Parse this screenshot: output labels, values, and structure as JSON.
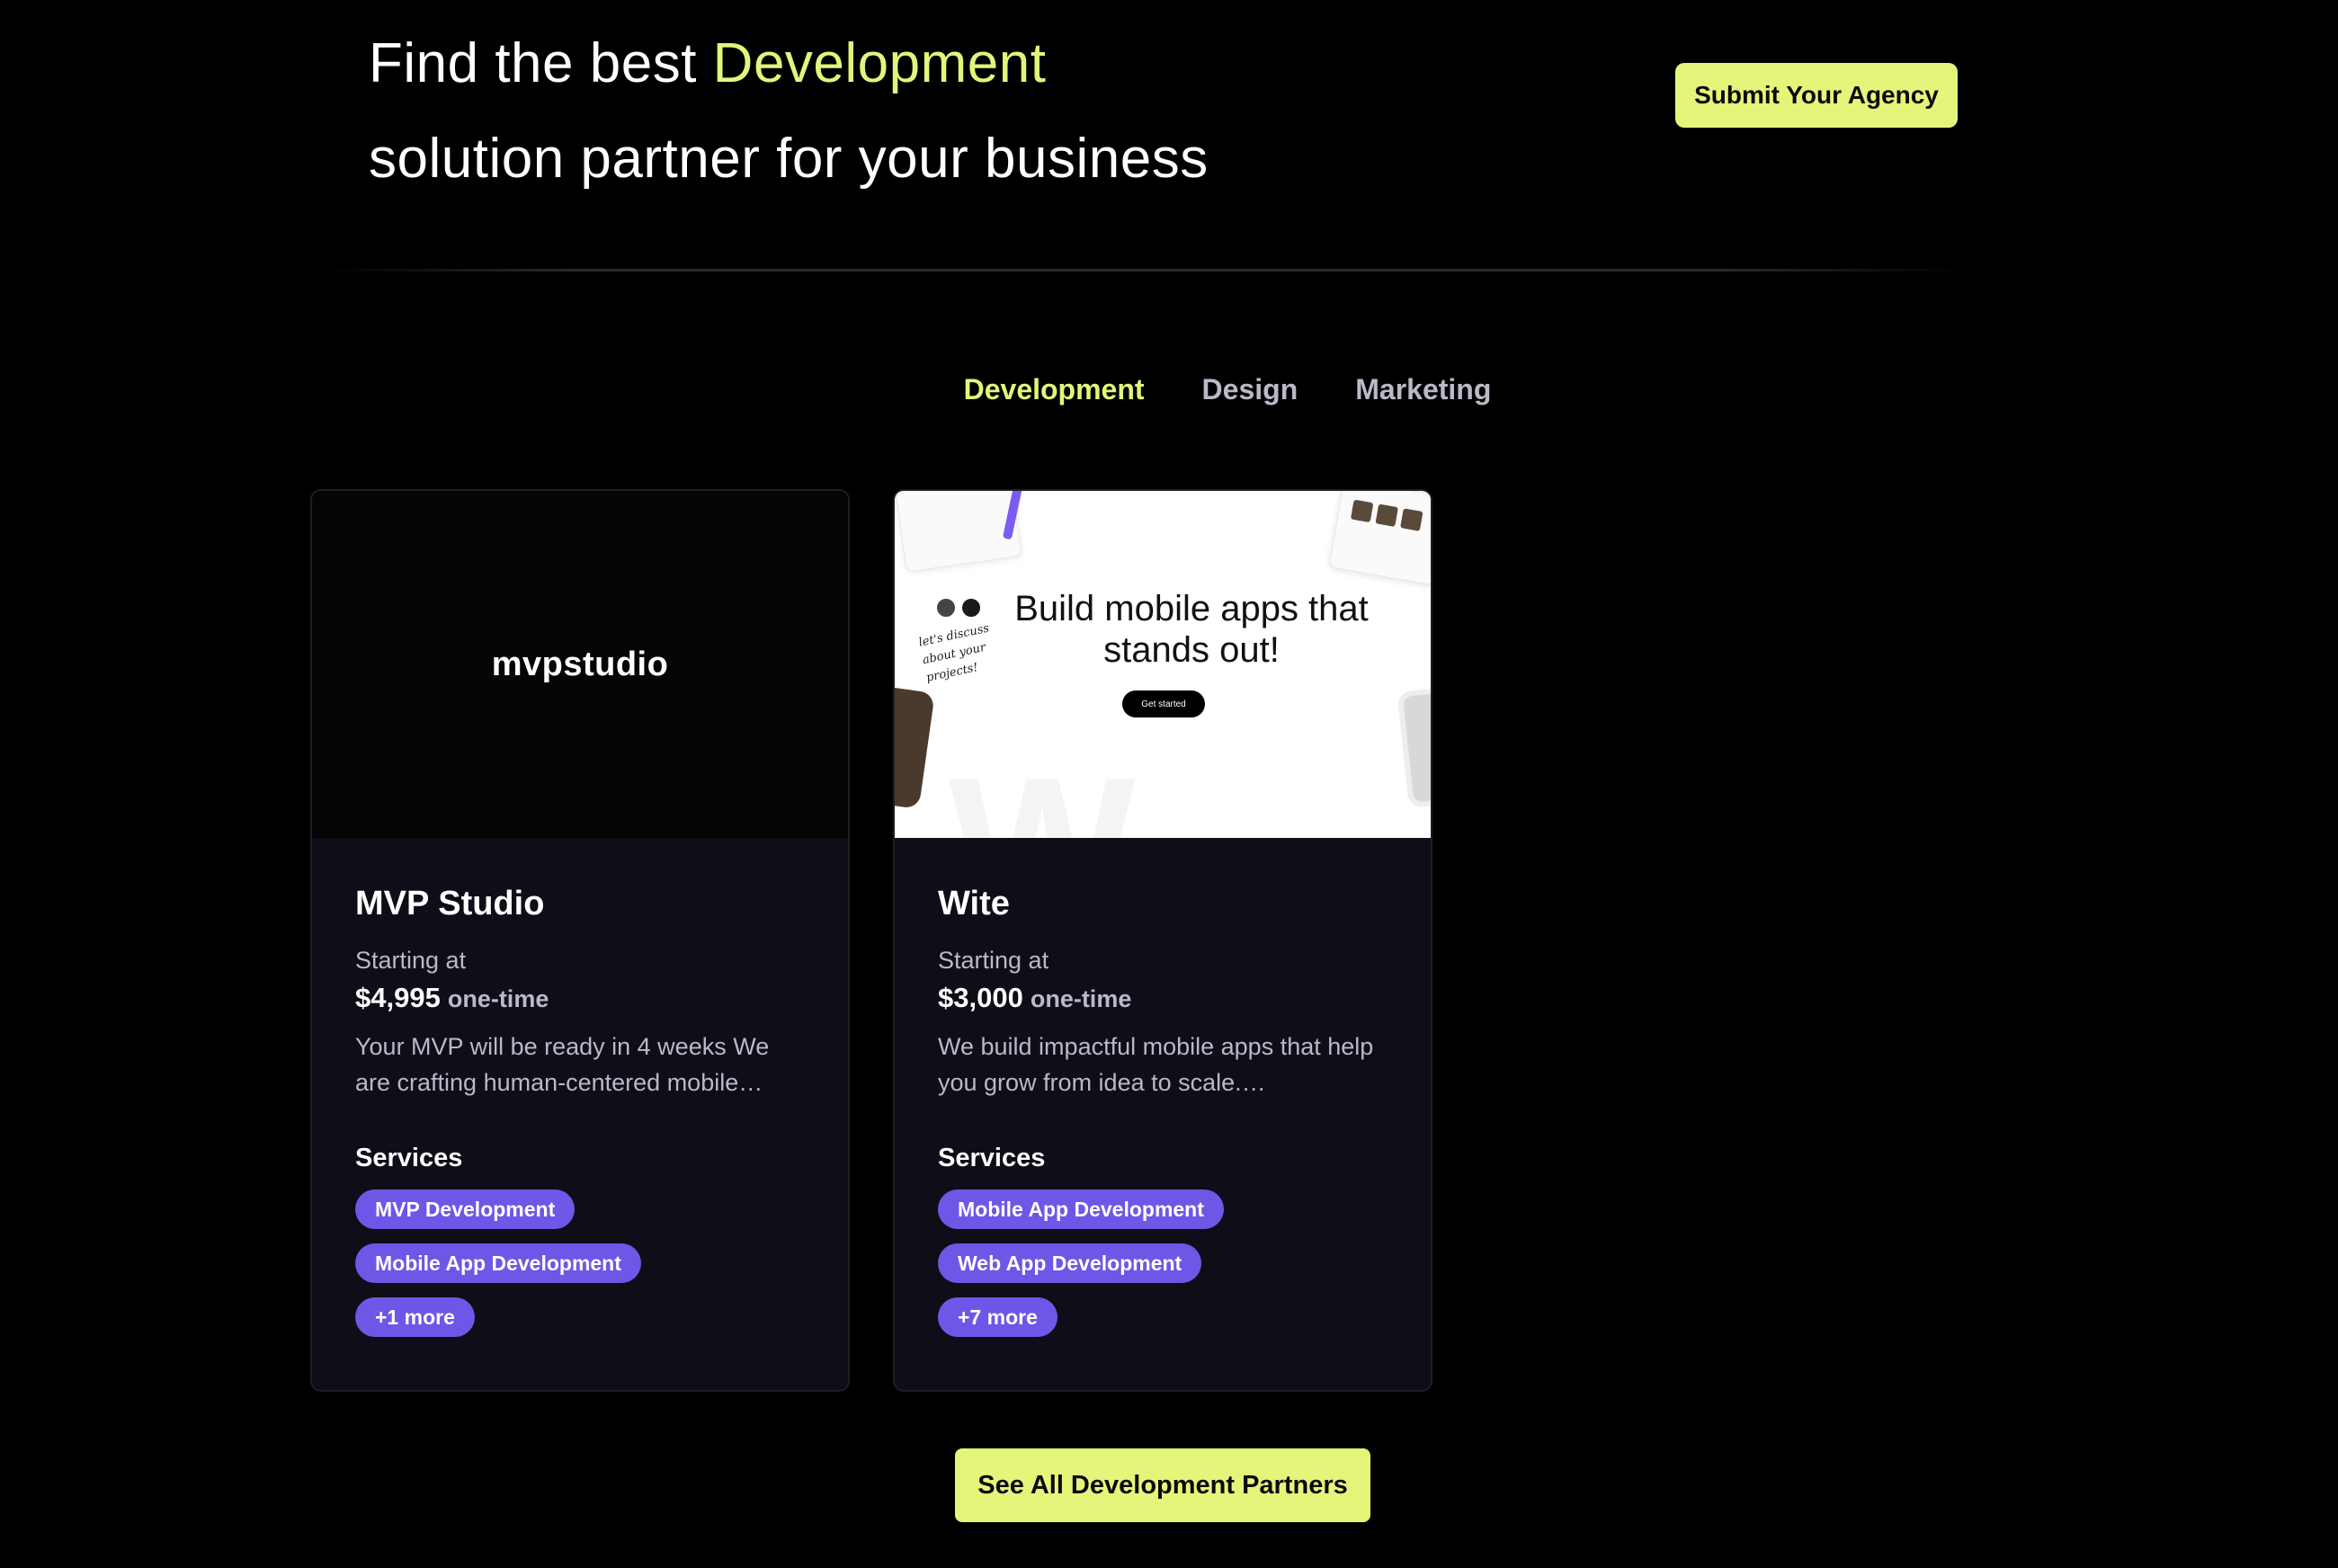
{
  "hero": {
    "title_prefix": "Find the best ",
    "title_accent": "Development",
    "title_suffix": "solution partner for your business",
    "submit_label": "Submit Your Agency"
  },
  "tabs": [
    {
      "label": "Development",
      "active": true
    },
    {
      "label": "Design",
      "active": false
    },
    {
      "label": "Marketing",
      "active": false
    }
  ],
  "cards": [
    {
      "logo_text": "mvpstudio",
      "name": "MVP Studio",
      "starting_label": "Starting at",
      "price": "$4,995",
      "price_unit": "one-time",
      "description": "Your MVP will be ready in 4 weeks We are crafting human-centered mobile…",
      "services_label": "Services",
      "services": [
        "MVP Development",
        "Mobile App Development",
        "+1 more"
      ]
    },
    {
      "media_headline": "Build mobile apps that stands out!",
      "media_cta": "Get started",
      "media_note": "let's discuss about your projects!",
      "name": "Wite",
      "starting_label": "Starting at",
      "price": "$3,000",
      "price_unit": "one-time",
      "description": "We build impactful mobile apps that help you grow from idea to scale.…",
      "services_label": "Services",
      "services": [
        "Mobile App Development",
        "Web App Development",
        "+7 more"
      ]
    }
  ],
  "footer": {
    "see_all_label": "See All Development Partners"
  },
  "colors": {
    "background": "#000000",
    "accent": "#e3f57a",
    "tag": "#6e57e6",
    "card": "#0e0d18",
    "muted_text": "#b9b9c7"
  }
}
